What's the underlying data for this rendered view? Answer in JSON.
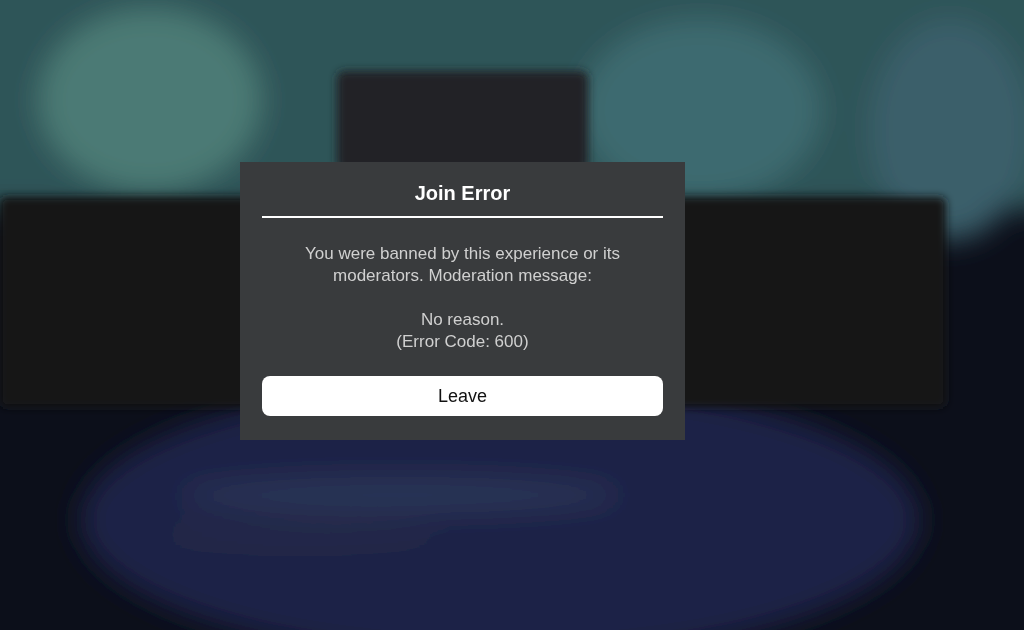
{
  "dialog": {
    "title": "Join Error",
    "message": "You were banned by this experience or its moderators. Moderation message:",
    "reason": "No reason.",
    "error_code": "(Error Code: 600)",
    "button": "Leave"
  }
}
